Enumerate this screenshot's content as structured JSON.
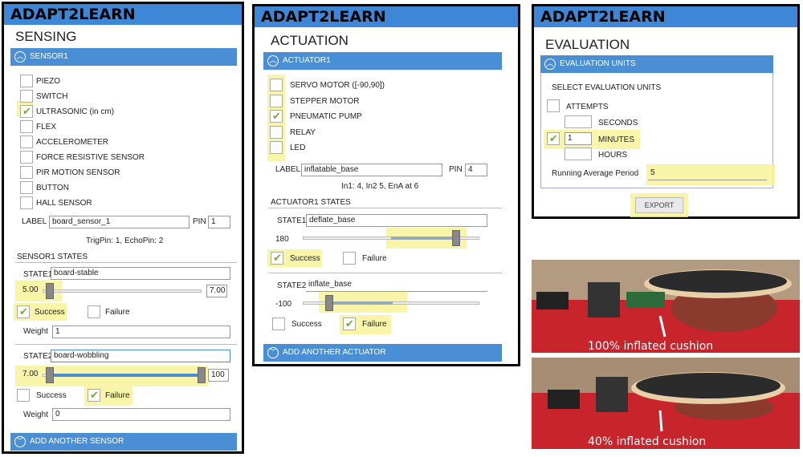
{
  "sensing": {
    "app": "ADAPT2LEARN",
    "title": "SENSING",
    "section": "SENSOR1",
    "sensors": [
      "PIEZO",
      "SWITCH",
      "ULTRASONIC (in cm)",
      "FLEX",
      "ACCELEROMETER",
      "FORCE RESISTIVE SENSOR",
      "PIR MOTION SENSOR",
      "BUTTON",
      "HALL SENSOR"
    ],
    "label_caption": "LABEL",
    "label_value": "board_sensor_1",
    "pin_caption": "PIN",
    "pin_value": "1",
    "pins": "TrigPin: 1, EchoPin: 2",
    "states_heading": "SENSOR1 STATES",
    "state1_caption": "STATE1",
    "state1_value": "board-stable",
    "state1_min": "5.00",
    "state1_max": "7.00",
    "success": "Success",
    "failure": "Failure",
    "weight_caption": "Weight",
    "weight1": "1",
    "state2_caption": "STATE2",
    "state2_value": "board-wobbling",
    "state2_min": "7.00",
    "state2_max": "100",
    "weight2": "0",
    "add": "ADD ANOTHER SENSOR"
  },
  "actuation": {
    "app": "ADAPT2LEARN",
    "title": "ACTUATION",
    "section": "ACTUATOR1",
    "actuators": [
      "SERVO MOTOR ([-90,90])",
      "STEPPER MOTOR",
      "PNEUMATIC PUMP",
      "RELAY",
      "LED"
    ],
    "label_caption": "LABEL",
    "label_value": "inflatable_base",
    "pin_caption": "PIN",
    "pin_value": "4",
    "pins": "In1: 4, In2 5, EnA at 6",
    "states_heading": "ACTUATOR1 STATES",
    "state1_caption": "STATE1",
    "state1_value": "deflate_base",
    "state1_num": "180",
    "success": "Success",
    "failure": "Failure",
    "state2_caption": "STATE2",
    "state2_value": "inflate_base",
    "state2_num": "-100",
    "add": "ADD ANOTHER ACTUATOR"
  },
  "evaluation": {
    "app": "ADAPT2LEARN",
    "title": "EVALUATION",
    "section": "EVALUATION UNITS",
    "select": "SELECT EVALUATION UNITS",
    "attempts": "ATTEMPTS",
    "seconds": "SECONDS",
    "minutes": "MINUTES",
    "minutes_value": "1",
    "hours": "HOURS",
    "running_caption": "Running Average Period",
    "running_value": "5",
    "export": "EXPORT"
  },
  "photos": {
    "top": "100% inflated cushion",
    "bottom": "40% inflated cushion"
  },
  "colors": {
    "accent": "#4a8fd5",
    "title_bar": "#3d87d6",
    "highlight": "#f7f39a",
    "check": "#7aa83a"
  }
}
